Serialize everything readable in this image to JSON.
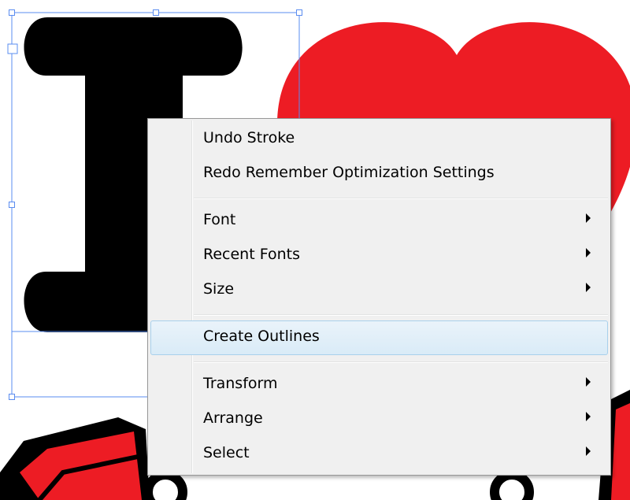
{
  "artwork": {
    "letter_color": "#000000",
    "heart_color": "#ed1c24",
    "selection_color": "#5a8cf0"
  },
  "context_menu": {
    "items": [
      {
        "label": "Undo Stroke",
        "has_submenu": false
      },
      {
        "label": "Redo Remember Optimization Settings",
        "has_submenu": false
      },
      {
        "label": "Font",
        "has_submenu": true
      },
      {
        "label": "Recent Fonts",
        "has_submenu": true
      },
      {
        "label": "Size",
        "has_submenu": true
      },
      {
        "label": "Create Outlines",
        "has_submenu": false,
        "highlighted": true
      },
      {
        "label": "Transform",
        "has_submenu": true
      },
      {
        "label": "Arrange",
        "has_submenu": true
      },
      {
        "label": "Select",
        "has_submenu": true
      }
    ]
  }
}
